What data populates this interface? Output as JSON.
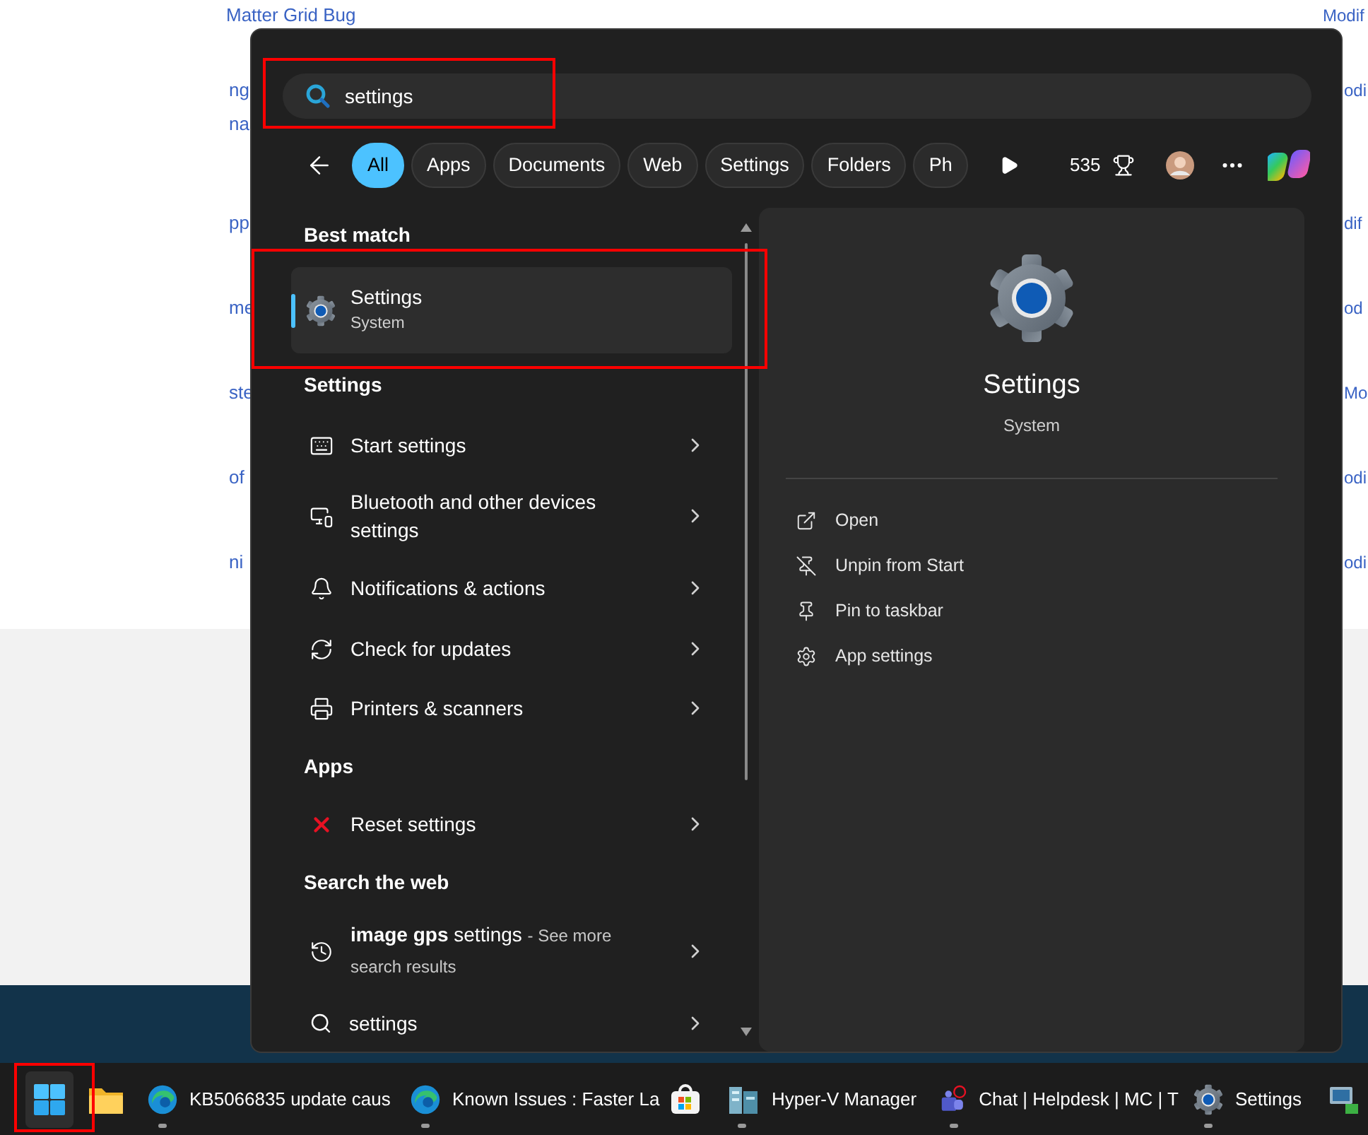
{
  "background_page": {
    "rows": [
      {
        "left": [
          "Matter Grid Bug"
        ],
        "right": "Modif"
      },
      {
        "left": [
          "ng",
          "na"
        ],
        "right": "odi"
      },
      {
        "left": [
          "pp"
        ],
        "right": "dif"
      },
      {
        "left": [
          "me"
        ],
        "right": "od"
      },
      {
        "left": [
          "ste"
        ],
        "right": "Mo"
      },
      {
        "left": [
          "of"
        ],
        "right": "odi"
      },
      {
        "left": [
          "ni"
        ],
        "right": "odi"
      }
    ]
  },
  "search": {
    "value": "settings"
  },
  "filters": [
    {
      "label": "All",
      "selected": true
    },
    {
      "label": "Apps",
      "selected": false
    },
    {
      "label": "Documents",
      "selected": false
    },
    {
      "label": "Web",
      "selected": false
    },
    {
      "label": "Settings",
      "selected": false
    },
    {
      "label": "Folders",
      "selected": false
    },
    {
      "label": "Ph",
      "selected": false
    }
  ],
  "points": "535",
  "results": [
    {
      "heading": "Best match",
      "items": [
        {
          "kind": "best",
          "title": "Settings",
          "subtitle": "System",
          "selected": true
        }
      ]
    },
    {
      "heading": "Settings",
      "items": [
        {
          "kind": "setting",
          "label": "Start settings",
          "selected": false
        },
        {
          "kind": "setting",
          "label": "Bluetooth and other devices settings",
          "selected": false
        },
        {
          "kind": "setting",
          "label": "Notifications & actions",
          "selected": false
        },
        {
          "kind": "setting",
          "label": "Check for updates",
          "selected": false
        },
        {
          "kind": "setting",
          "label": "Printers & scanners",
          "selected": false
        }
      ]
    },
    {
      "heading": "Apps",
      "items": [
        {
          "kind": "app",
          "label": "Reset settings",
          "selected": false
        }
      ]
    },
    {
      "heading": "Search the web",
      "items": [
        {
          "kind": "web",
          "label": "**image gps** settings",
          "note": "- See more search results",
          "selected": false
        },
        {
          "kind": "query",
          "label": "settings",
          "selected": false
        }
      ]
    }
  ],
  "preview": {
    "title": "Settings",
    "subtitle": "System",
    "actions": [
      "Open",
      "Unpin from Start",
      "Pin to taskbar",
      "App settings"
    ]
  },
  "taskbar": {
    "apps": [
      {
        "running": false
      },
      {
        "label": "KB5066835 update caus",
        "running": true
      },
      {
        "label": "Known Issues : Faster La",
        "running": true
      },
      {
        "running": false
      },
      {
        "label": "Hyper-V Manager",
        "running": true
      },
      {
        "label": "Chat | Helpdesk | MC | T",
        "running": true
      },
      {
        "label": "Settings",
        "running": true
      },
      {
        "running": false
      }
    ]
  }
}
